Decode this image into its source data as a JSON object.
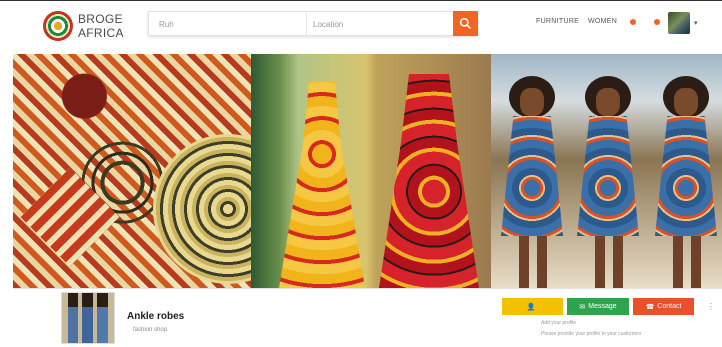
{
  "brand": {
    "line1": "BROGE",
    "line2": "AFRICA"
  },
  "search": {
    "query_placeholder": "Ruh",
    "location_placeholder": "Location"
  },
  "nav": {
    "link1": "FURNITURE",
    "link2": "WOMEN"
  },
  "banner": {
    "panels": [
      "fabric-pattern",
      "dresses",
      "models"
    ]
  },
  "shop": {
    "name": "Ankle robes",
    "subtitle": "fashion shop"
  },
  "actions": {
    "follow_label": "",
    "message_label": "Message",
    "contact_label": "Contact"
  },
  "info": {
    "line1": "Add your profile",
    "line2": "Please provide your profile to your customers"
  },
  "colors": {
    "accent": "#f06522",
    "yellow": "#f2c200",
    "green": "#2ea44f",
    "red": "#e8512a"
  }
}
